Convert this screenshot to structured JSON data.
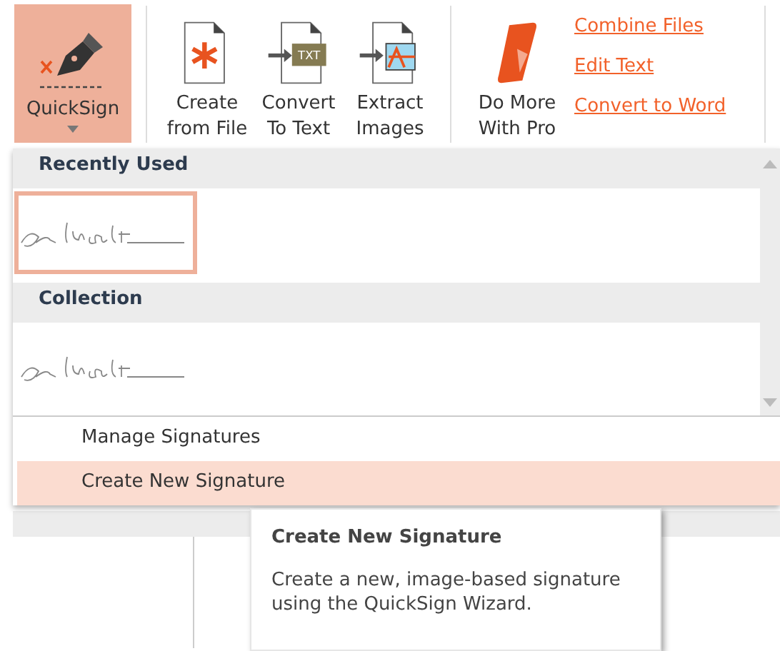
{
  "ribbon": {
    "quicksign": {
      "label": "QuickSign",
      "selected": true
    },
    "buttons": [
      {
        "kind": "create",
        "lines": [
          "Create",
          "from File"
        ]
      },
      {
        "kind": "text",
        "lines": [
          "Convert",
          "To Text"
        ],
        "badge": "TXT"
      },
      {
        "kind": "images",
        "lines": [
          "Extract",
          "Images"
        ]
      }
    ],
    "pro": {
      "lines": [
        "Do More",
        "With Pro"
      ]
    },
    "links": [
      "Combine Files",
      "Edit Text",
      "Convert to Word"
    ]
  },
  "signature_menu": {
    "sections": [
      {
        "title": "Recently Used",
        "signatures": [
          {
            "selected": true
          }
        ]
      },
      {
        "title": "Collection",
        "signatures": [
          {
            "selected": false
          }
        ]
      }
    ],
    "items": [
      {
        "label": "Manage Signatures",
        "selected": false
      },
      {
        "label": "Create New Signature",
        "selected": true
      }
    ]
  },
  "tooltip": {
    "title": "Create New Signature",
    "text": "Create a new, image-based signature using the QuickSign Wizard."
  }
}
